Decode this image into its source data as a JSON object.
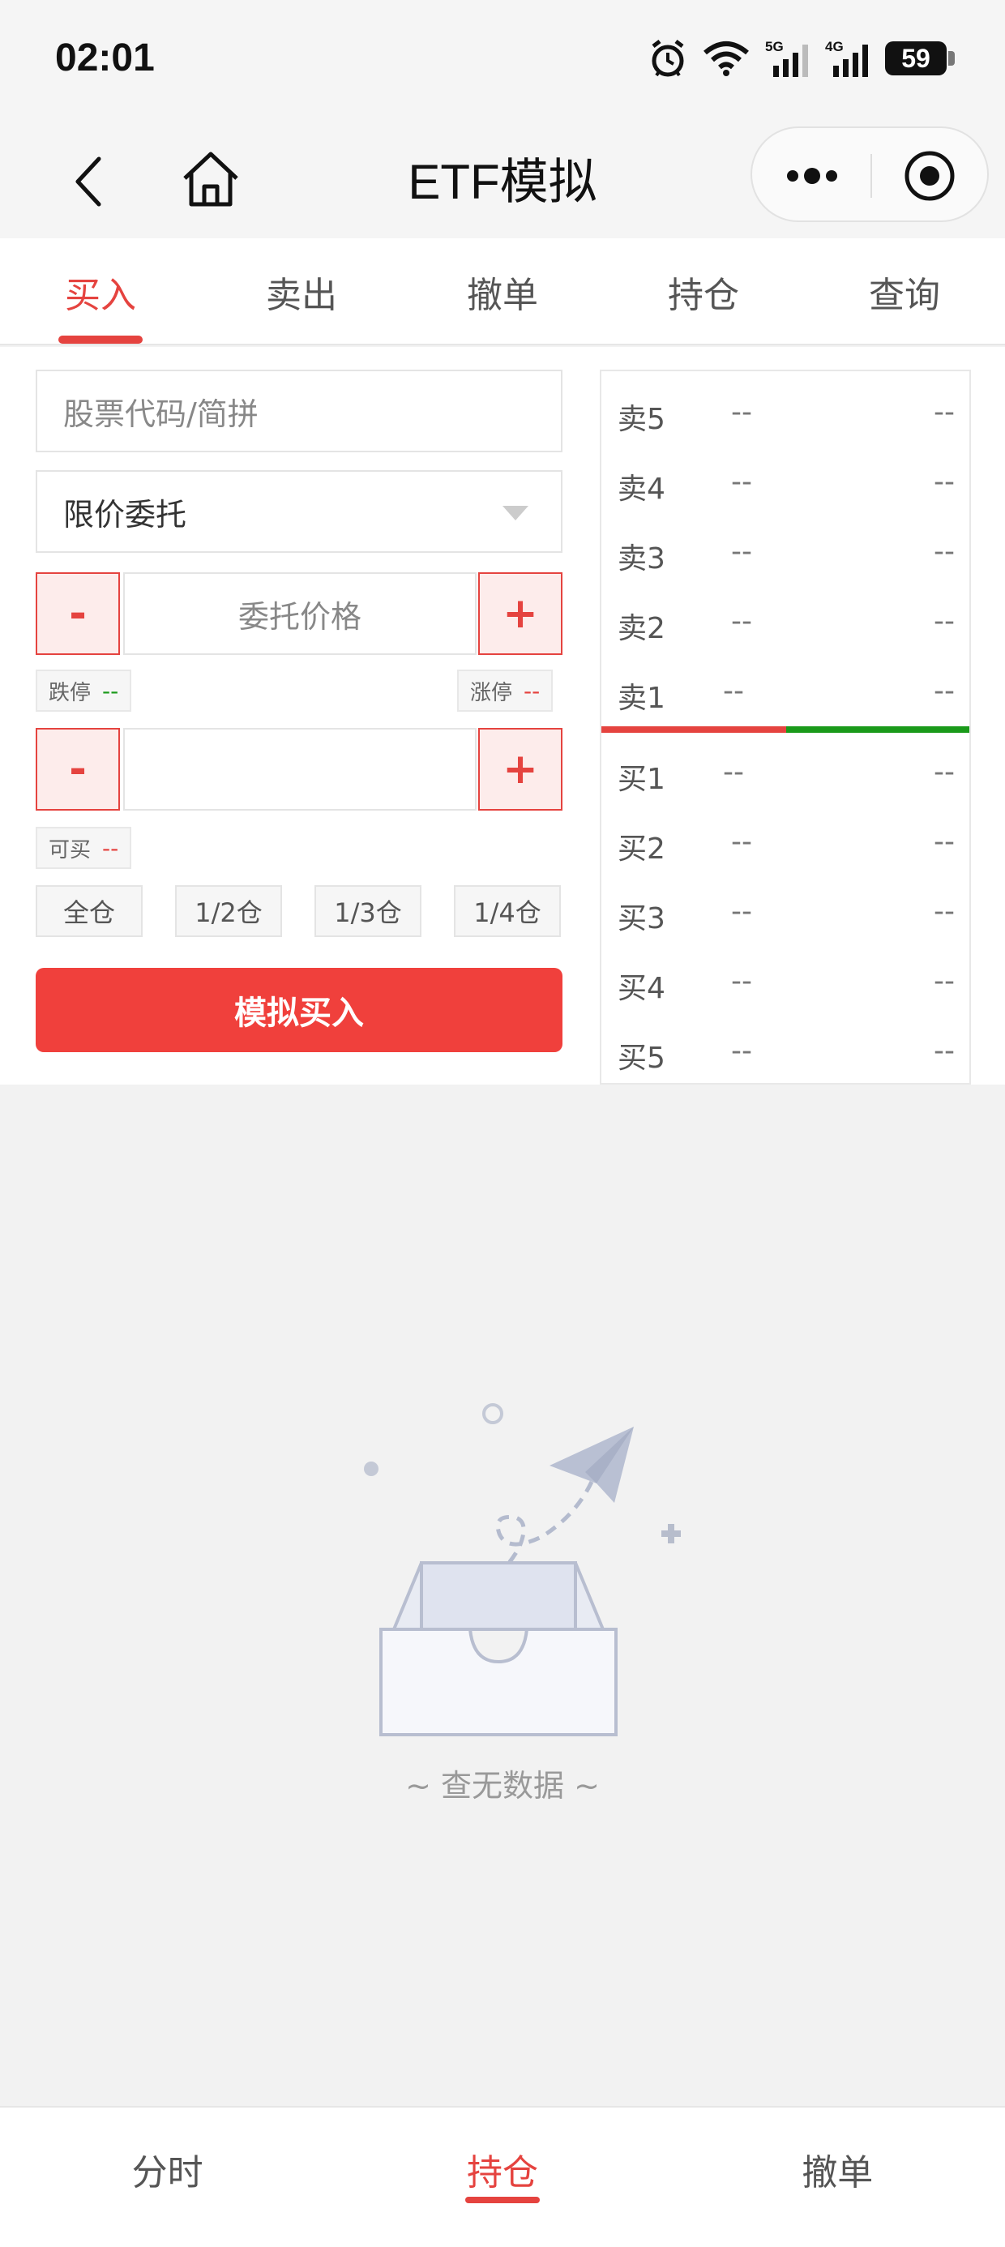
{
  "status_bar": {
    "time": "02:01",
    "battery": "59",
    "icons": [
      "alarm-icon",
      "wifi-icon",
      "signal-5g-icon",
      "signal-4g-icon",
      "battery-icon"
    ],
    "network_5g": "5G",
    "network_4g": "4G"
  },
  "nav": {
    "title": "ETF模拟",
    "icons": [
      "back-icon",
      "home-icon",
      "more-icon",
      "close-capsule-icon"
    ]
  },
  "tabs": [
    {
      "label": "买入",
      "active": true
    },
    {
      "label": "卖出",
      "active": false
    },
    {
      "label": "撤单",
      "active": false
    },
    {
      "label": "持仓",
      "active": false
    },
    {
      "label": "查询",
      "active": false
    }
  ],
  "form": {
    "stock_placeholder": "股票代码/简拼",
    "order_type": "限价委托",
    "price_placeholder": "委托价格",
    "minus": "-",
    "plus": "+",
    "limit_down_label": "跌停",
    "limit_down_value": "--",
    "limit_up_label": "涨停",
    "limit_up_value": "--",
    "quantity_value": "",
    "available_label": "可买",
    "available_value": "--",
    "position_buttons": [
      "全仓",
      "1/2仓",
      "1/3仓",
      "1/4仓"
    ],
    "submit_label": "模拟买入"
  },
  "order_book": {
    "sell": [
      {
        "label": "卖5",
        "price": "--",
        "volume": "--"
      },
      {
        "label": "卖4",
        "price": "--",
        "volume": "--"
      },
      {
        "label": "卖3",
        "price": "--",
        "volume": "--"
      },
      {
        "label": "卖2",
        "price": "--",
        "volume": "--"
      },
      {
        "label": "卖1",
        "price": "--",
        "volume": "--"
      }
    ],
    "buy": [
      {
        "label": "买1",
        "price": "--",
        "volume": "--"
      },
      {
        "label": "买2",
        "price": "--",
        "volume": "--"
      },
      {
        "label": "买3",
        "price": "--",
        "volume": "--"
      },
      {
        "label": "买4",
        "price": "--",
        "volume": "--"
      },
      {
        "label": "买5",
        "price": "--",
        "volume": "--"
      }
    ],
    "colors": {
      "sell": "#e5433f",
      "buy": "#1a9a1a"
    }
  },
  "empty": {
    "text": "~ 查无数据 ~",
    "icon": "empty-inbox-icon"
  },
  "bottom_nav": [
    {
      "label": "分时",
      "active": false
    },
    {
      "label": "持仓",
      "active": true
    },
    {
      "label": "撤单",
      "active": false
    }
  ],
  "colors": {
    "accent": "#e5433f",
    "buy_button": "#f0403c",
    "up_green": "#1a9a1a"
  }
}
